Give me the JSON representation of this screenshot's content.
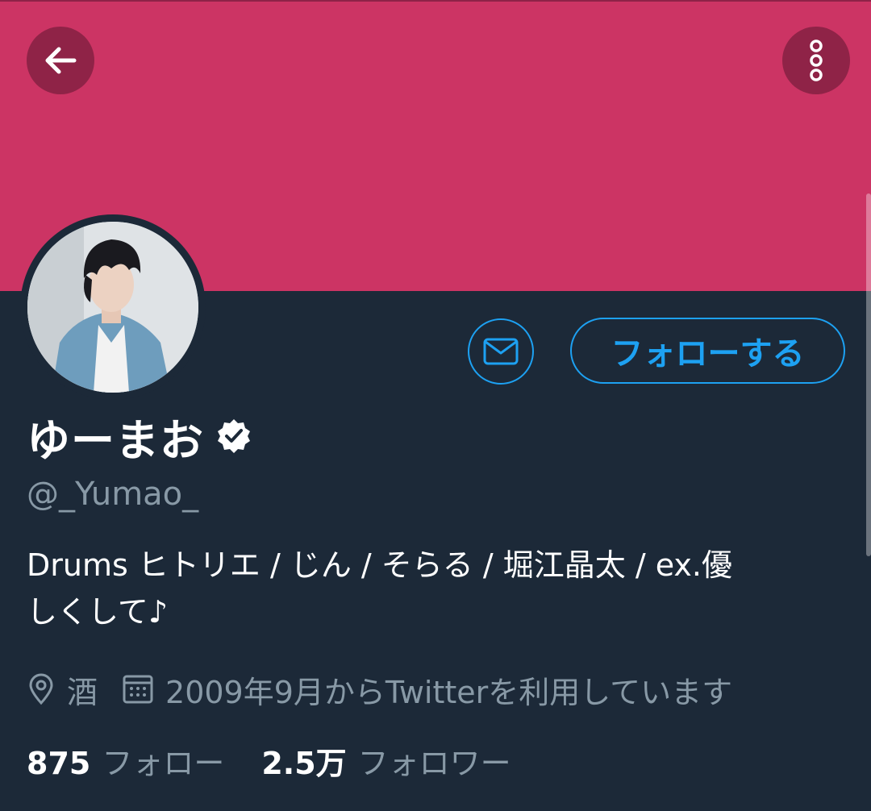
{
  "colors": {
    "banner": "#cc3464",
    "background": "#1c2938",
    "accent": "#1da1f2",
    "secondary_text": "#8899a6"
  },
  "header": {
    "back_icon": "arrow-left-icon",
    "more_icon": "more-vertical-icon"
  },
  "profile": {
    "name": "ゆーまお",
    "verified": true,
    "handle": "@_Yumao_",
    "bio_line1": "Drums ヒトリエ / じん / そらる / 堀江晶太 / ex.優",
    "bio_line2": "しくして♪",
    "location": "酒",
    "joined": "2009年9月からTwitterを利用しています"
  },
  "actions": {
    "message_icon": "mail-icon",
    "follow_label": "フォローする"
  },
  "stats": {
    "following_count": "875",
    "following_label": "フォロー",
    "followers_count": "2.5万",
    "followers_label": "フォロワー"
  }
}
